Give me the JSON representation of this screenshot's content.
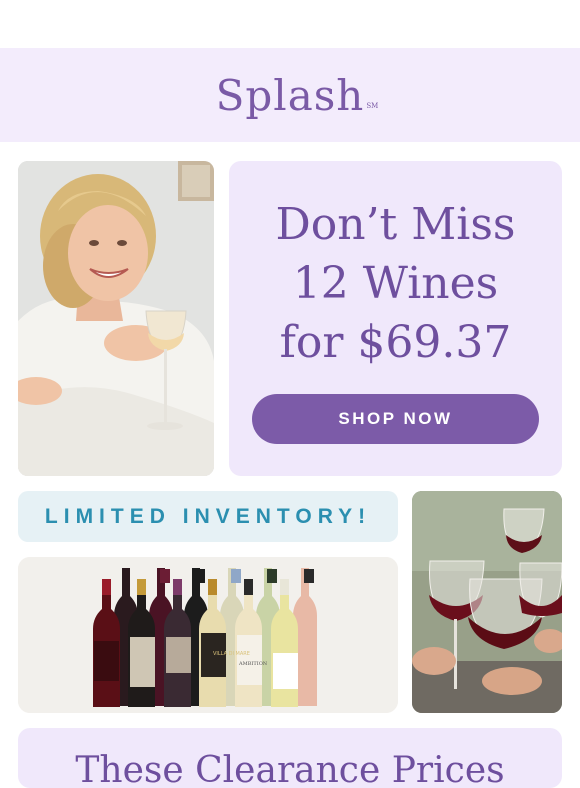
{
  "header": {
    "brand": "Splash",
    "brand_mark": "SM"
  },
  "hero": {
    "title_line1": "Don’t Miss",
    "title_line2": "12 Wines",
    "title_line3": "for $69.37",
    "cta_label": "SHOP NOW"
  },
  "banner": {
    "label": "LIMITED INVENTORY!"
  },
  "product": {
    "bottle_labels": [
      "VILLA DI MARE",
      "AMBITION"
    ]
  },
  "bottom": {
    "title": "These Clearance Prices"
  },
  "colors": {
    "brand_purple": "#7c5ba8",
    "lavender_bg": "#f0e8fb",
    "teal_text": "#2b8fb0"
  }
}
